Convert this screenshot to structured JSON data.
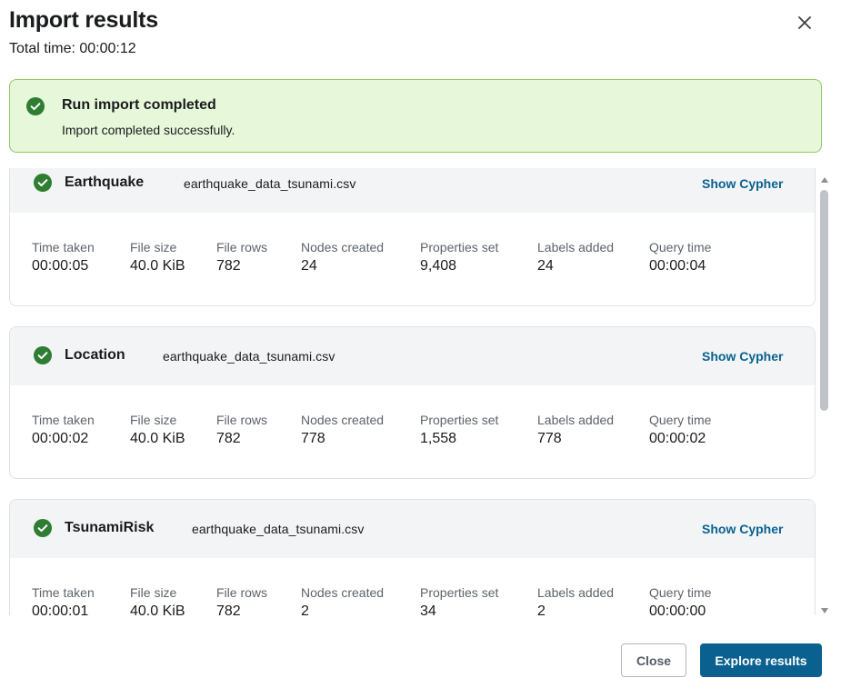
{
  "dialog": {
    "title": "Import results",
    "total_time": "Total time: 00:00:12"
  },
  "banner": {
    "title": "Run import completed",
    "message": "Import completed successfully.",
    "color": "#e6f8d9",
    "border_color": "#90cb62"
  },
  "stat_labels": {
    "time_taken": "Time taken",
    "file_size": "File size",
    "file_rows": "File rows",
    "nodes_created": "Nodes created",
    "properties_set": "Properties set",
    "labels_added": "Labels added",
    "query_time": "Query time"
  },
  "results": [
    {
      "label": "Earthquake",
      "file": "earthquake_data_tsunami.csv",
      "action": "Show Cypher",
      "time_taken": "00:00:05",
      "file_size": "40.0 KiB",
      "file_rows": "782",
      "nodes_created": "24",
      "properties_set": "9,408",
      "labels_added": "24",
      "query_time": "00:00:04"
    },
    {
      "label": "Location",
      "file": "earthquake_data_tsunami.csv",
      "action": "Show Cypher",
      "time_taken": "00:00:02",
      "file_size": "40.0 KiB",
      "file_rows": "782",
      "nodes_created": "778",
      "properties_set": "1,558",
      "labels_added": "778",
      "query_time": "00:00:02"
    },
    {
      "label": "TsunamiRisk",
      "file": "earthquake_data_tsunami.csv",
      "action": "Show Cypher",
      "time_taken": "00:00:01",
      "file_size": "40.0 KiB",
      "file_rows": "782",
      "nodes_created": "2",
      "properties_set": "34",
      "labels_added": "2",
      "query_time": "00:00:00"
    }
  ],
  "footer": {
    "close_label": "Close",
    "explore_label": "Explore results"
  },
  "icons": {
    "success": "check-circle-icon",
    "close": "close-icon"
  },
  "colors": {
    "success_green": "#2e7d32",
    "link_blue": "#0a6190",
    "primary_button": "#0a6190"
  }
}
